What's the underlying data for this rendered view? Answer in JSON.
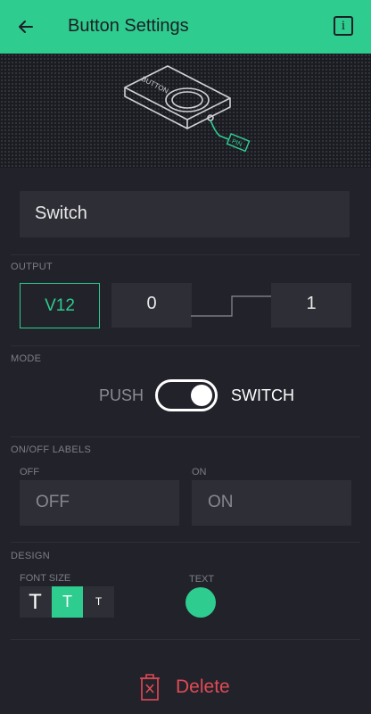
{
  "header": {
    "title": "Button Settings",
    "back_icon": "arrow-left-icon",
    "info_icon": "info-icon",
    "info_glyph": "i",
    "bg_color": "#2ecc8f"
  },
  "hero": {
    "device_label": "BUTTON",
    "pin_label": "PIN"
  },
  "name_field": {
    "value": "Switch"
  },
  "output": {
    "section_label": "OUTPUT",
    "pin": "V12",
    "min_value": "0",
    "max_value": "1"
  },
  "mode": {
    "section_label": "MODE",
    "left_option": "PUSH",
    "right_option": "SWITCH",
    "selected": "SWITCH"
  },
  "onoff_labels": {
    "section_label": "ON/OFF LABELS",
    "off_caption": "OFF",
    "on_caption": "ON",
    "off_value": "OFF",
    "on_value": "ON"
  },
  "design": {
    "section_label": "DESIGN",
    "font_size_label": "FONT SIZE",
    "font_sizes": [
      "T",
      "T",
      "T"
    ],
    "selected_font_size_index": 1,
    "text_color_label": "TEXT",
    "text_color": "#2ecc8f"
  },
  "delete": {
    "label": "Delete",
    "icon": "trash-icon",
    "color": "#e04a55"
  }
}
